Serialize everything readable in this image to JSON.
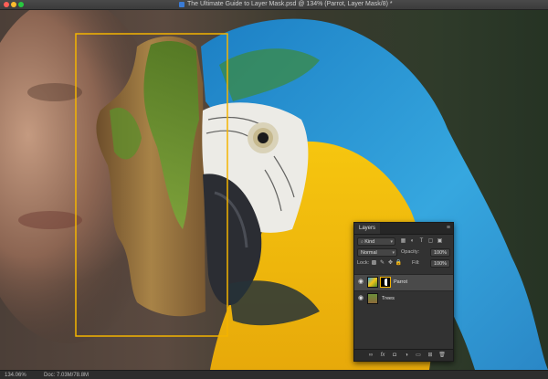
{
  "window": {
    "title": "The Ultimate Guide to Layer Mask.psd @ 134% (Parrot, Layer Mask/8) *",
    "traffic_lights": [
      "close",
      "minimize",
      "zoom"
    ]
  },
  "canvas": {
    "selection_color": "#f4b400"
  },
  "status_bar": {
    "zoom": "134.06%",
    "doc_size": "Doc: 7.03M/78.8M"
  },
  "layers_panel": {
    "tab_label": "Layers",
    "menu_icon": "≡",
    "filter": {
      "label": "Kind",
      "icons": [
        "image-filter-icon",
        "adjustment-filter-icon",
        "type-filter-icon",
        "shape-filter-icon",
        "smart-object-filter-icon"
      ]
    },
    "blend_mode": "Normal",
    "opacity_label": "Opacity:",
    "opacity_value": "100%",
    "lock_label": "Lock:",
    "fill_label": "Fill:",
    "fill_value": "100%",
    "layers": [
      {
        "name": "Parrot",
        "visible": true,
        "selected": true,
        "has_mask": true
      },
      {
        "name": "Trees",
        "visible": true,
        "selected": false,
        "has_mask": false
      }
    ],
    "bottom_icons": [
      "link-layers-icon",
      "fx-icon",
      "add-mask-icon",
      "adjustment-layer-icon",
      "new-group-icon",
      "new-layer-icon",
      "delete-layer-icon"
    ]
  }
}
